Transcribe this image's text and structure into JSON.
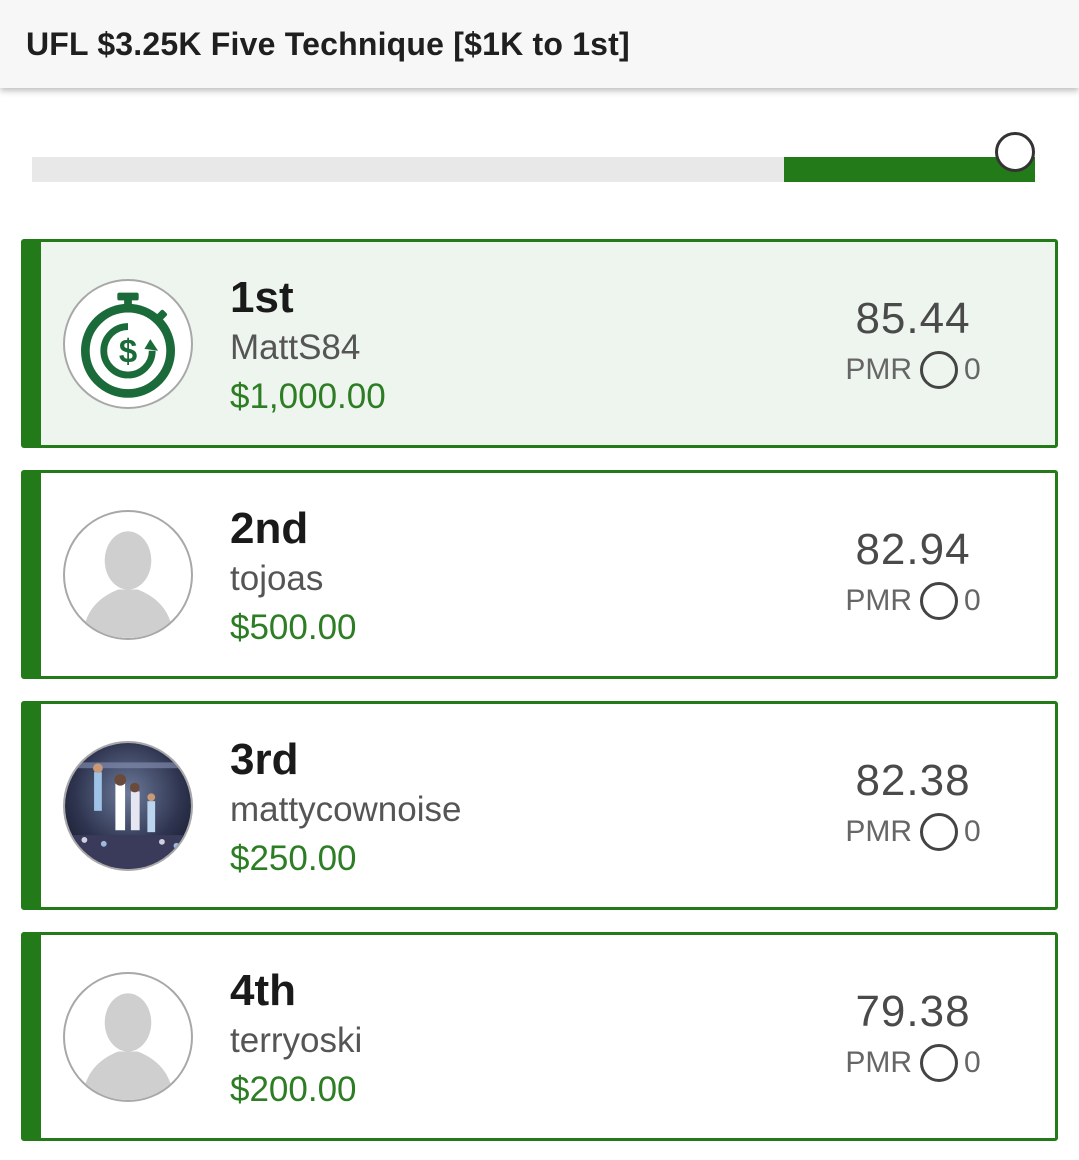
{
  "header": {
    "title": "UFL $3.25K Five Technique [$1K to 1st]"
  },
  "progress": {
    "fill_fraction": 0.25,
    "thumb_position_fraction": 1.0
  },
  "colors": {
    "accent": "#227a19",
    "prize": "#2c7d23",
    "highlight_bg": "#eef5ee"
  },
  "entries": [
    {
      "rank": "1st",
      "username": "MattS84",
      "prize": "$1,000.00",
      "score": "85.44",
      "pmr_label": "PMR",
      "pmr_value": "0",
      "avatar": "dollar-stopwatch-icon",
      "highlighted": true
    },
    {
      "rank": "2nd",
      "username": "tojoas",
      "prize": "$500.00",
      "score": "82.94",
      "pmr_label": "PMR",
      "pmr_value": "0",
      "avatar": "default-person-icon"
    },
    {
      "rank": "3rd",
      "username": "mattycownoise",
      "prize": "$250.00",
      "score": "82.38",
      "pmr_label": "PMR",
      "pmr_value": "0",
      "avatar": "basketball-photo"
    },
    {
      "rank": "4th",
      "username": "terryoski",
      "prize": "$200.00",
      "score": "79.38",
      "pmr_label": "PMR",
      "pmr_value": "0",
      "avatar": "default-person-icon"
    }
  ]
}
